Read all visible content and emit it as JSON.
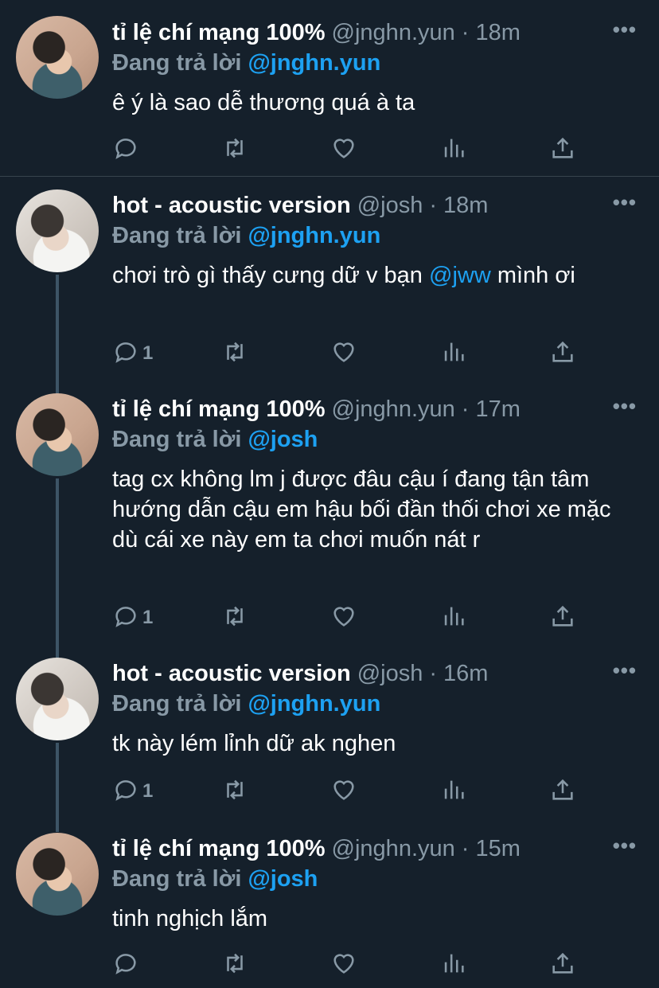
{
  "colors": {
    "background": "#15202b",
    "secondary_text": "#8899a6",
    "link": "#1da1f2",
    "thread_line": "#3d5466"
  },
  "tweets": [
    {
      "display_name": "tỉ lệ chí mạng 100%",
      "handle": "@jnghn.yun",
      "dot": "·",
      "time": "18m",
      "replying_prefix": "Đang trả lời",
      "replying_to": "@jnghn.yun",
      "text": "ê ý là sao dễ thương quá à ta",
      "reply_count": "",
      "more_icon": "more-horizontal-icon"
    },
    {
      "display_name": "hot - acoustic version",
      "handle": "@josh",
      "dot": "·",
      "time": "18m",
      "replying_prefix": "Đang trả lời",
      "replying_to": "@jnghn.yun",
      "text_before": "chơi trò gì thấy cưng dữ v bạn ",
      "text_mention": "@jww",
      "text_after": " mình ơi",
      "reply_count": "1",
      "more_icon": "more-horizontal-icon"
    },
    {
      "display_name": "tỉ lệ chí mạng 100%",
      "handle": "@jnghn.yun",
      "dot": "·",
      "time": "17m",
      "replying_prefix": "Đang trả lời",
      "replying_to": "@josh",
      "text": "tag cx không lm j được đâu cậu í đang tận tâm hướng dẫn cậu em hậu bối đần thối chơi xe mặc dù cái xe này em ta chơi muốn nát r",
      "reply_count": "1",
      "more_icon": "more-horizontal-icon"
    },
    {
      "display_name": "hot - acoustic version",
      "handle": "@josh",
      "dot": "·",
      "time": "16m",
      "replying_prefix": "Đang trả lời",
      "replying_to": "@jnghn.yun",
      "text": "tk này lém lỉnh dữ ak nghen",
      "reply_count": "1",
      "more_icon": "more-horizontal-icon"
    },
    {
      "display_name": "tỉ lệ chí mạng 100%",
      "handle": "@jnghn.yun",
      "dot": "·",
      "time": "15m",
      "replying_prefix": "Đang trả lời",
      "replying_to": "@josh",
      "text": "tinh nghịch lắm",
      "reply_count": "",
      "more_icon": "more-horizontal-icon"
    }
  ],
  "action_icons": [
    "reply-icon",
    "retweet-icon",
    "like-icon",
    "analytics-icon",
    "share-icon"
  ]
}
